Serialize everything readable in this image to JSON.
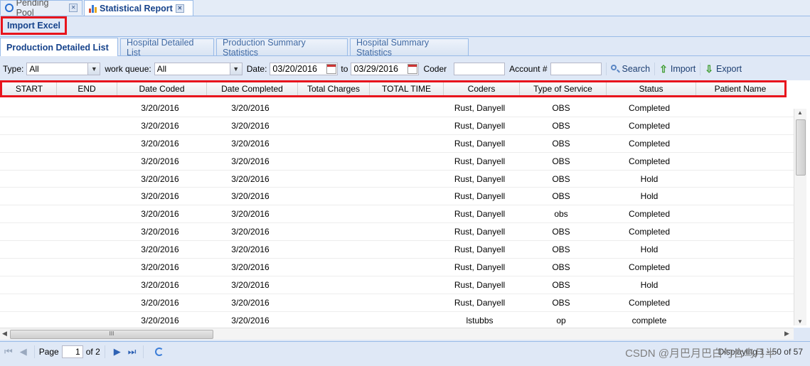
{
  "window_tabs": [
    {
      "label": "Pending Pool",
      "icon": "clock-icon"
    },
    {
      "label": "Statistical Report",
      "icon": "bar-chart-icon"
    }
  ],
  "import_excel_label": "Import Excel",
  "sub_tabs": [
    "Production Detailed List",
    "Hospital Detailed List",
    "Production Summary Statistics",
    "Hospital Summary Statistics"
  ],
  "filters": {
    "type_label": "Type:",
    "type_value": "All",
    "work_queue_label": "work queue:",
    "work_queue_value": "All",
    "date_label": "Date:",
    "date_from": "03/20/2016",
    "to_label": "to",
    "date_to": "03/29/2016",
    "coder_label": "Coder",
    "coder_value": "",
    "account_label": "Account #",
    "account_value": "",
    "search_label": "Search",
    "import_label": "Import",
    "export_label": "Export"
  },
  "grid": {
    "columns": [
      "START",
      "END",
      "Date Coded",
      "Date Completed",
      "Total Charges",
      "TOTAL TIME",
      "Coders",
      "Type of Service",
      "Status",
      "Patient Name"
    ],
    "rows": [
      [
        "",
        "",
        "3/20/2016",
        "3/20/2016",
        "",
        "",
        "Rust, Danyell",
        "OBS",
        "Completed",
        ""
      ],
      [
        "",
        "",
        "3/20/2016",
        "3/20/2016",
        "",
        "",
        "Rust, Danyell",
        "OBS",
        "Completed",
        ""
      ],
      [
        "",
        "",
        "3/20/2016",
        "3/20/2016",
        "",
        "",
        "Rust, Danyell",
        "OBS",
        "Completed",
        ""
      ],
      [
        "",
        "",
        "3/20/2016",
        "3/20/2016",
        "",
        "",
        "Rust, Danyell",
        "OBS",
        "Completed",
        ""
      ],
      [
        "",
        "",
        "3/20/2016",
        "3/20/2016",
        "",
        "",
        "Rust, Danyell",
        "OBS",
        "Hold",
        ""
      ],
      [
        "",
        "",
        "3/20/2016",
        "3/20/2016",
        "",
        "",
        "Rust, Danyell",
        "OBS",
        "Hold",
        ""
      ],
      [
        "",
        "",
        "3/20/2016",
        "3/20/2016",
        "",
        "",
        "Rust, Danyell",
        "obs",
        "Completed",
        ""
      ],
      [
        "",
        "",
        "3/20/2016",
        "3/20/2016",
        "",
        "",
        "Rust, Danyell",
        "OBS",
        "Completed",
        ""
      ],
      [
        "",
        "",
        "3/20/2016",
        "3/20/2016",
        "",
        "",
        "Rust, Danyell",
        "OBS",
        "Hold",
        ""
      ],
      [
        "",
        "",
        "3/20/2016",
        "3/20/2016",
        "",
        "",
        "Rust, Danyell",
        "OBS",
        "Completed",
        ""
      ],
      [
        "",
        "",
        "3/20/2016",
        "3/20/2016",
        "",
        "",
        "Rust, Danyell",
        "OBS",
        "Hold",
        ""
      ],
      [
        "",
        "",
        "3/20/2016",
        "3/20/2016",
        "",
        "",
        "Rust, Danyell",
        "OBS",
        "Completed",
        ""
      ],
      [
        "",
        "",
        "3/20/2016",
        "3/20/2016",
        "",
        "",
        "lstubbs",
        "op",
        "complete",
        ""
      ]
    ]
  },
  "paging": {
    "page_label": "Page",
    "page_value": "1",
    "of_label": "of 2",
    "display_info": "Displaying 1 - 50 of 57"
  },
  "watermark": "CSDN @月巴月巴白勺合鸟月半"
}
